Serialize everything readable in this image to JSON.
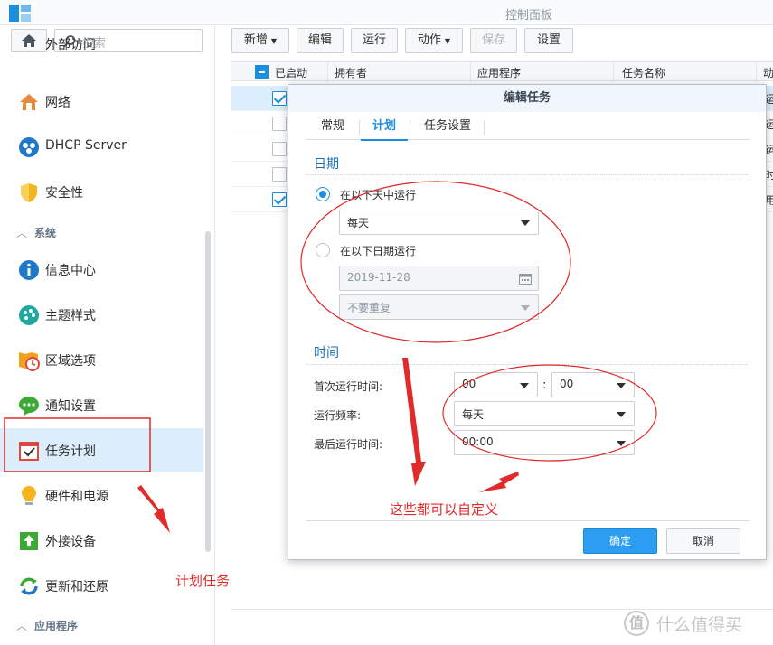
{
  "window": {
    "title": "控制面板"
  },
  "sidebar": {
    "search_placeholder": "搜索",
    "items": [
      {
        "label": "外部访问",
        "icon": "external-access-icon"
      },
      {
        "label": "网络",
        "icon": "network-icon"
      },
      {
        "label": "DHCP Server",
        "icon": "dhcp-server-icon"
      },
      {
        "label": "安全性",
        "icon": "security-shield-icon"
      },
      {
        "label": "信息中心",
        "icon": "info-icon"
      },
      {
        "label": "主题样式",
        "icon": "theme-palette-icon"
      },
      {
        "label": "区域选项",
        "icon": "regional-options-icon"
      },
      {
        "label": "通知设置",
        "icon": "notification-icon"
      },
      {
        "label": "任务计划",
        "icon": "task-scheduler-icon",
        "active": true
      },
      {
        "label": "硬件和电源",
        "icon": "hardware-power-icon"
      },
      {
        "label": "外接设备",
        "icon": "external-devices-icon"
      },
      {
        "label": "更新和还原",
        "icon": "update-restore-icon"
      }
    ],
    "sections": {
      "system": "系统",
      "apps": "应用程序"
    }
  },
  "toolbar": {
    "create": "新增",
    "edit": "编辑",
    "run": "运行",
    "action": "动作",
    "save": "保存",
    "settings": "设置"
  },
  "table": {
    "headers": [
      "已启动",
      "拥有者",
      "应用程序",
      "任务名称",
      "动"
    ],
    "rows": [
      {
        "enabled": true,
        "selected": true,
        "tail": "运"
      },
      {
        "enabled": false,
        "selected": false,
        "tail": "运"
      },
      {
        "enabled": false,
        "selected": false,
        "tail": "运"
      },
      {
        "enabled": false,
        "selected": false,
        "tail": "时"
      },
      {
        "enabled": true,
        "selected": false,
        "tail": "用"
      }
    ]
  },
  "dialog": {
    "title": "编辑任务",
    "tabs": [
      "常规",
      "计划",
      "任务设置"
    ],
    "active_tab": "计划",
    "date_section": "日期",
    "radio_daily": "在以下天中运行",
    "daily_value": "每天",
    "radio_date": "在以下日期运行",
    "date_value": "2019-11-28",
    "repeat_value": "不要重复",
    "time_section": "时间",
    "first_run_label": "首次运行时间:",
    "first_run_hour": "00",
    "first_run_minute": "00",
    "frequency_label": "运行频率:",
    "frequency_value": "每天",
    "last_run_label": "最后运行时间:",
    "last_run_value": "00:00",
    "ok": "确定",
    "cancel": "取消"
  },
  "annotations": {
    "customizable": "这些都可以自定义",
    "scheduled_task": "计划任务",
    "color": "#e12a2a"
  },
  "watermark": {
    "symbol": "值",
    "text": "什么值得买"
  }
}
